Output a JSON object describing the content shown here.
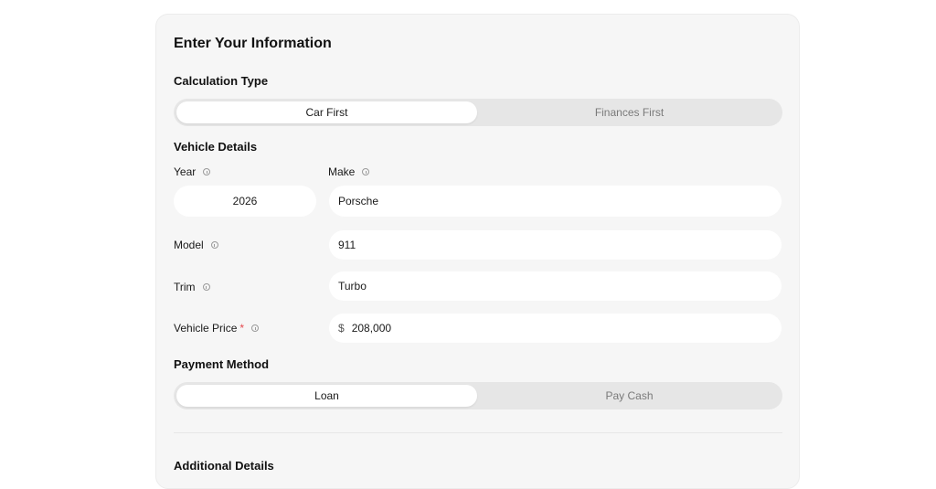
{
  "card": {
    "title": "Enter Your Information"
  },
  "calculation_type": {
    "title": "Calculation Type",
    "options": [
      "Car First",
      "Finances First"
    ],
    "selected": "Car First"
  },
  "vehicle": {
    "title": "Vehicle Details",
    "year": {
      "label": "Year",
      "value": "2026"
    },
    "make": {
      "label": "Make",
      "value": "Porsche"
    },
    "model": {
      "label": "Model",
      "value": "911"
    },
    "trim": {
      "label": "Trim",
      "value": "Turbo"
    },
    "price": {
      "label": "Vehicle Price",
      "required_mark": "*",
      "currency": "$",
      "value": "208,000"
    }
  },
  "payment_method": {
    "title": "Payment Method",
    "options": [
      "Loan",
      "Pay Cash"
    ],
    "selected": "Loan"
  },
  "additional": {
    "title": "Additional Details"
  },
  "icons": {
    "info": "info-circle-icon"
  }
}
